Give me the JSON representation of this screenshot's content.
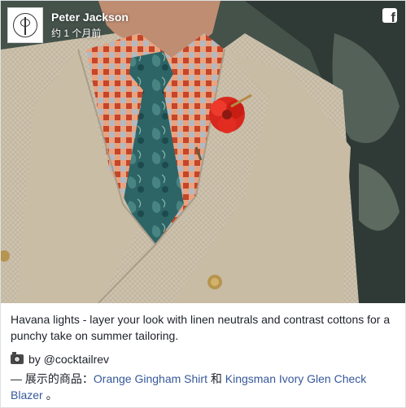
{
  "post": {
    "author": "Peter Jackson",
    "time": "约 1 个月前",
    "body": "Havana lights - layer your look with linen neutrals and contrast cottons for a punchy take on summer tailoring.",
    "credit": "by @cocktailrev",
    "shop_prefix": "— 展示的商品：",
    "product_1": "Orange Gingham Shirt",
    "connector": " 和 ",
    "product_2": "Kingsman Ivory Glen Check Blazer",
    "shop_suffix": " 。"
  },
  "icons": {
    "avatar": "monogram-logo",
    "network": "facebook-icon",
    "credit": "camera-icon"
  },
  "colors": {
    "link": "#365899",
    "text": "#1d2129",
    "blazer": "#cfc4ae",
    "tie": "#2f6b6e",
    "flower": "#e0261d"
  }
}
